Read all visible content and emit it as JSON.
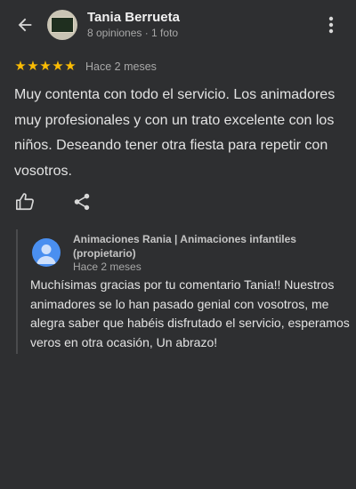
{
  "header": {
    "back_icon": "arrow-back-icon",
    "reviewer_name": "Tania Berrueta",
    "reviewer_meta": "8 opiniones · 1 foto",
    "more_icon": "more-vertical-icon"
  },
  "review": {
    "rating": 5,
    "rating_max": 5,
    "star_color": "#fbbc04",
    "time": "Hace 2 meses",
    "text": "Muy contenta con todo el servicio. Los animadores muy profesionales y con un trato excelente con los niños. Deseando tener otra fiesta para repetir con vosotros."
  },
  "actions": {
    "like_icon": "thumbs-up-icon",
    "share_icon": "share-icon"
  },
  "owner_reply": {
    "name": "Animaciones Rania | Animaciones infantiles (propietario)",
    "time": "Hace 2 meses",
    "avatar_color": "#4a8ff0",
    "text": "Muchísimas gracias por tu comentario Tania!! Nuestros animadores se lo han pasado genial con vosotros, me alegra saber que habéis disfrutado el servicio, esperamos veros en otra ocasión, Un abrazo!"
  },
  "colors": {
    "background": "#2e2f31",
    "text_primary": "#e3e3e3",
    "text_secondary": "#a8a8a8"
  }
}
